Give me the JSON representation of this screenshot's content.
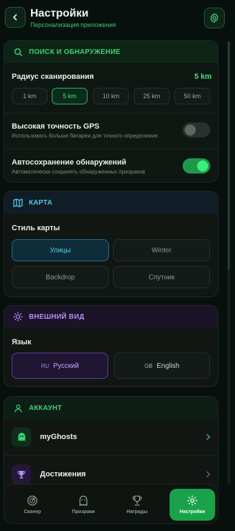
{
  "header": {
    "title": "Настройки",
    "subtitle": "Персонализация приложения"
  },
  "search_section": {
    "title": "ПОИСК И ОБНАРУЖЕНИЕ",
    "radius_label": "Радиус сканирования",
    "radius_value": "5 km",
    "radius_options": [
      "1 km",
      "5 km",
      "10 km",
      "25 km",
      "50 km"
    ],
    "radius_selected": "5 km",
    "gps": {
      "label": "Высокая точность GPS",
      "desc": "Использовать больше батареи для точного определения",
      "enabled": false
    },
    "autosave": {
      "label": "Автосохранение обнаружений",
      "desc": "Автоматически сохранять обнаруженных призраков",
      "enabled": true
    }
  },
  "map_section": {
    "title": "КАРТА",
    "style_label": "Стиль карты",
    "styles": [
      "Улицы",
      "Winter",
      "Backdrop",
      "Спутник"
    ],
    "selected": "Улицы"
  },
  "appearance_section": {
    "title": "ВНЕШНИЙ ВИД",
    "language_label": "Язык",
    "languages": [
      {
        "code": "RU",
        "name": "Русский"
      },
      {
        "code": "GB",
        "name": "English"
      }
    ],
    "selected": "RU"
  },
  "account_section": {
    "title": "АККАУНТ",
    "items": [
      {
        "label": "myGhosts",
        "icon": "ghost-icon"
      },
      {
        "label": "Достижения",
        "icon": "trophy-icon"
      }
    ]
  },
  "bottom_nav": {
    "items": [
      {
        "label": "Сканер",
        "icon": "radar-icon"
      },
      {
        "label": "Призраки",
        "icon": "ghost-icon"
      },
      {
        "label": "Награды",
        "icon": "trophy-icon"
      },
      {
        "label": "Настройки",
        "icon": "gear-icon"
      }
    ],
    "active": "Настройки"
  },
  "colors": {
    "accent_green": "#2ecf6e",
    "map_accent": "#5fd3f0",
    "appearance_accent": "#b98cff",
    "background": "#07100c"
  }
}
